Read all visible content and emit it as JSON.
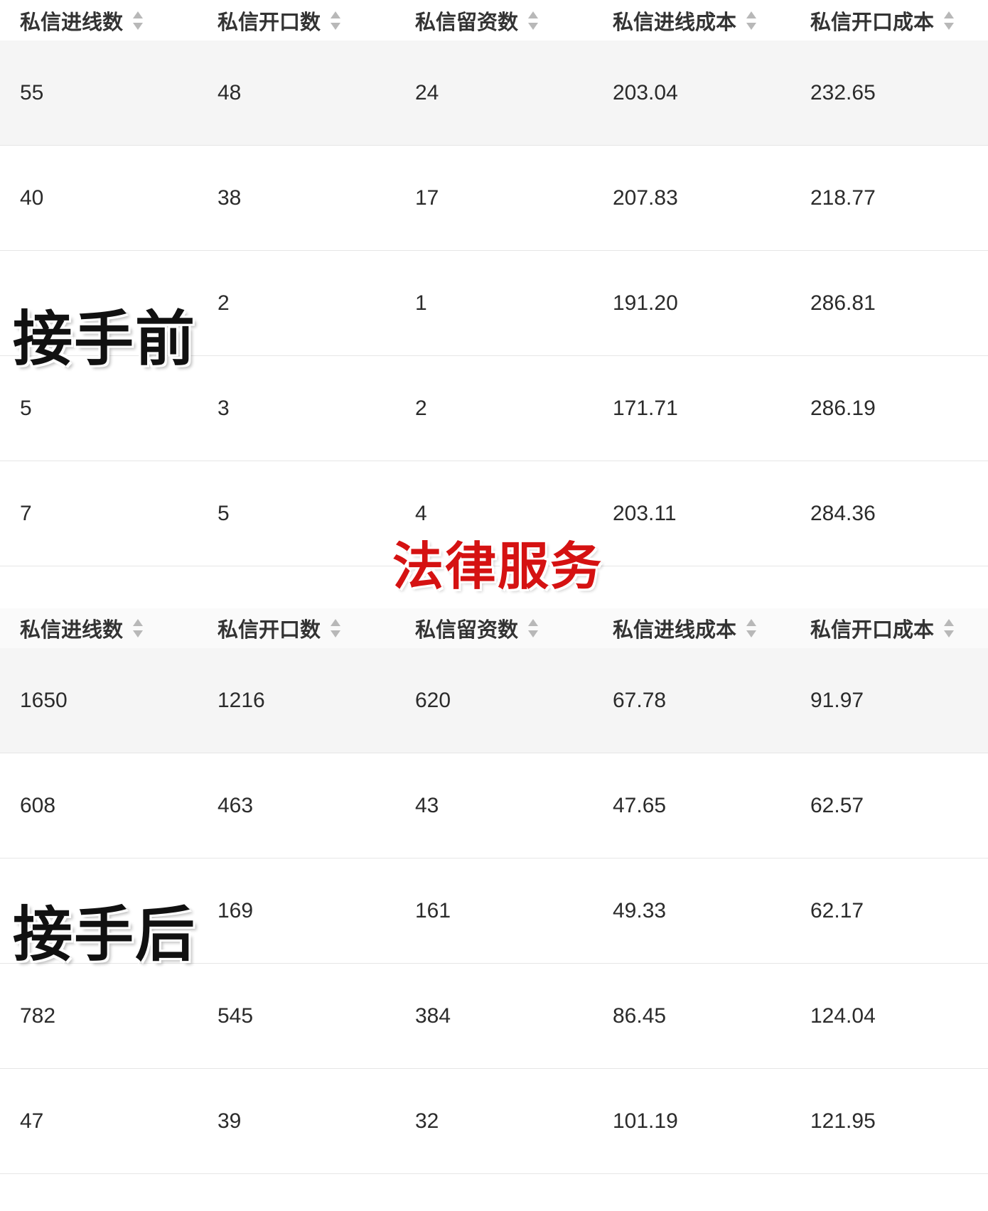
{
  "columns": [
    "私信进线数",
    "私信开口数",
    "私信留资数",
    "私信进线成本",
    "私信开口成本"
  ],
  "before": {
    "rows": [
      [
        "55",
        "48",
        "24",
        "203.04",
        "232.65"
      ],
      [
        "40",
        "38",
        "17",
        "207.83",
        "218.77"
      ],
      [
        "",
        "2",
        "1",
        "191.20",
        "286.81"
      ],
      [
        "5",
        "3",
        "2",
        "171.71",
        "286.19"
      ],
      [
        "7",
        "5",
        "4",
        "203.11",
        "284.36"
      ]
    ]
  },
  "after": {
    "rows": [
      [
        "1650",
        "1216",
        "620",
        "67.78",
        "91.97"
      ],
      [
        "608",
        "463",
        "43",
        "47.65",
        "62.57"
      ],
      [
        "",
        "169",
        "161",
        "49.33",
        "62.17"
      ],
      [
        "782",
        "545",
        "384",
        "86.45",
        "124.04"
      ],
      [
        "47",
        "39",
        "32",
        "101.19",
        "121.95"
      ]
    ]
  },
  "overlays": {
    "before_label": "接手前",
    "after_label": "接手后",
    "title": "法律服务"
  }
}
